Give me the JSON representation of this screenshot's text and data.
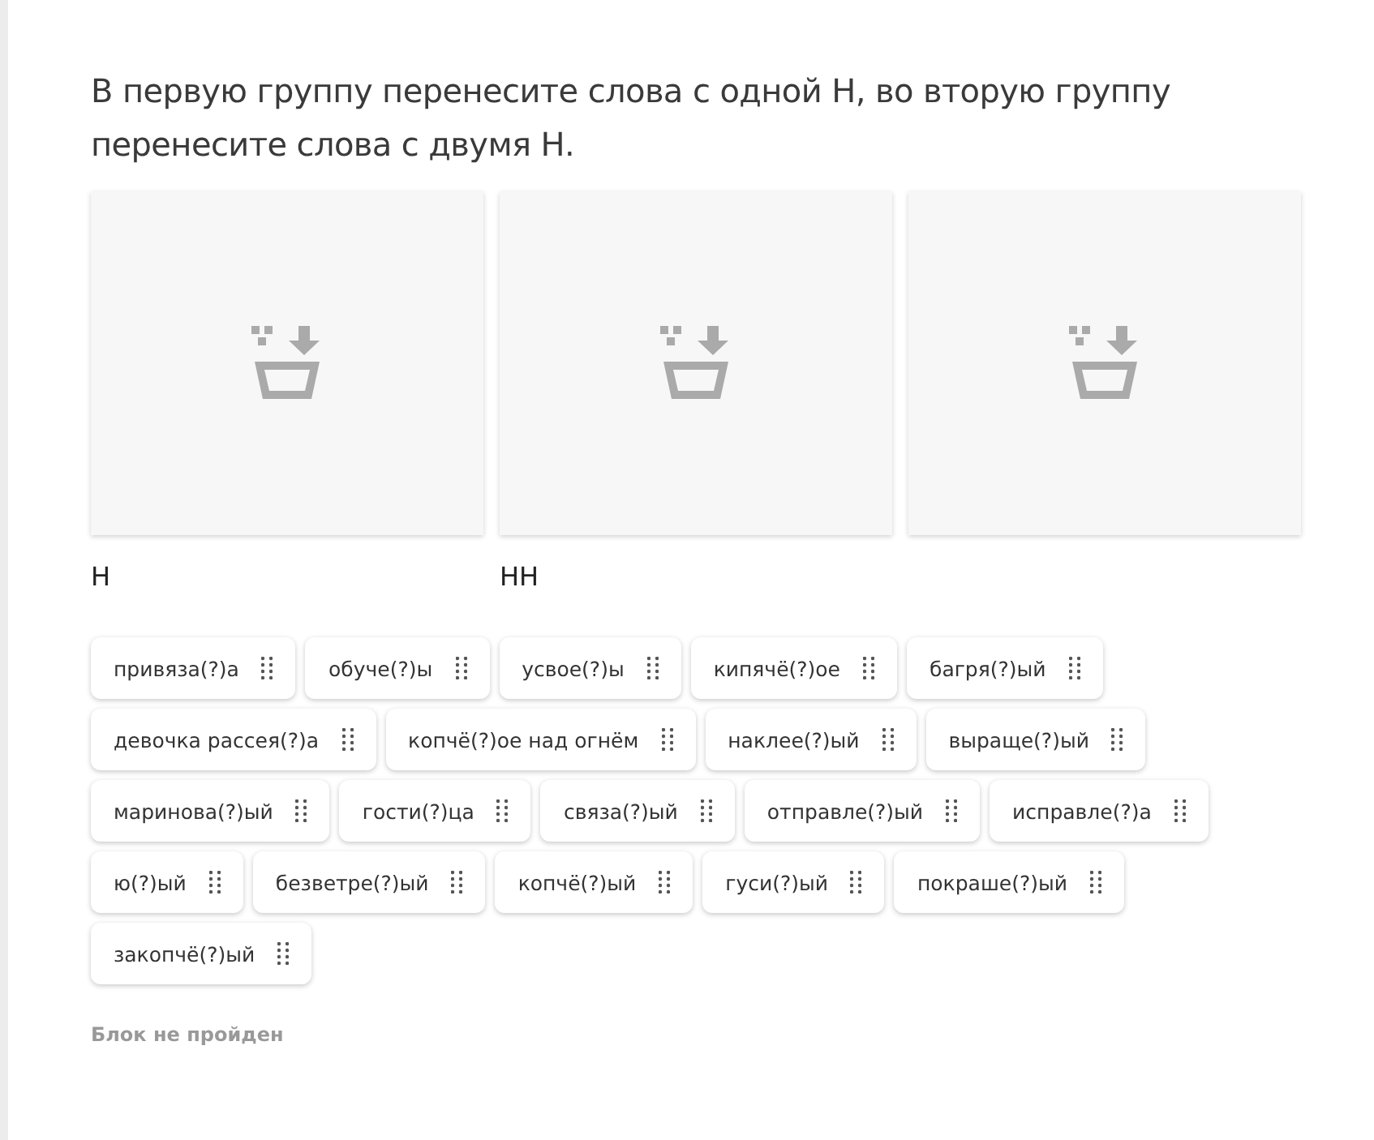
{
  "task": {
    "instruction": "В первую группу перенесите слова с одной Н, во вторую группу перенесите слова с двумя Н."
  },
  "zones": [
    {
      "kind": "labeled",
      "label": "Н"
    },
    {
      "kind": "labeled",
      "label": "НН"
    },
    {
      "kind": "unlabeled"
    }
  ],
  "words": [
    "привяза(?)а",
    "обуче(?)ы",
    "усвое(?)ы",
    "кипячё(?)ое",
    "багря(?)ый",
    "девочка рассея(?)а",
    "копчё(?)ое над огнём",
    "наклее(?)ый",
    "выраще(?)ый",
    "маринова(?)ый",
    "гости(?)ца",
    "связа(?)ый",
    "отправле(?)ый",
    "исправле(?)а",
    "ю(?)ый",
    "безветре(?)ый",
    "копчё(?)ый",
    "гуси(?)ый",
    "покраше(?)ый",
    "закопчё(?)ый"
  ],
  "status": "Блок не пройден"
}
